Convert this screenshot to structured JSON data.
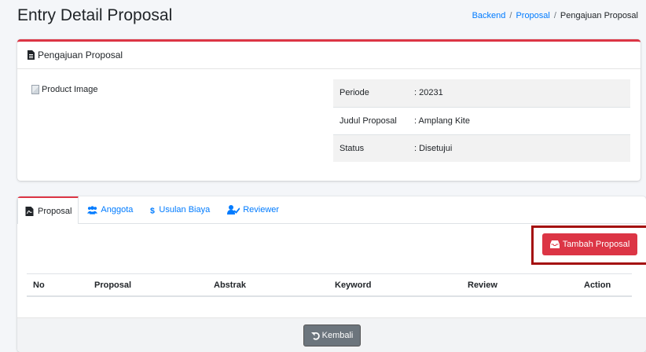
{
  "header": {
    "title": "Entry Detail Proposal",
    "breadcrumb": {
      "home": "Backend",
      "section": "Proposal",
      "current": "Pengajuan Proposal"
    }
  },
  "detail_card": {
    "title": "Pengajuan Proposal",
    "image_alt": "Product Image",
    "rows": [
      {
        "label": "Periode",
        "value": ": 20231"
      },
      {
        "label": "Judul Proposal",
        "value": ": Amplang Kite"
      },
      {
        "label": "Status",
        "value": ": Disetujui"
      }
    ]
  },
  "tabs": [
    {
      "label": "Proposal",
      "icon": "file-pdf-icon",
      "active": true
    },
    {
      "label": "Anggota",
      "icon": "users-icon",
      "active": false
    },
    {
      "label": "Usulan Biaya",
      "icon": "dollar-icon",
      "active": false
    },
    {
      "label": "Reviewer",
      "icon": "user-check-icon",
      "active": false
    }
  ],
  "proposal_tab": {
    "add_button": "Tambah Proposal",
    "columns": [
      "No",
      "Proposal",
      "Abstrak",
      "Keyword",
      "Review",
      "Action"
    ]
  },
  "footer": {
    "back_button": "Kembali"
  },
  "colors": {
    "accent": "#dc3545",
    "link": "#007bff",
    "secondary": "#6c757d",
    "highlight": "#a40f0f"
  }
}
